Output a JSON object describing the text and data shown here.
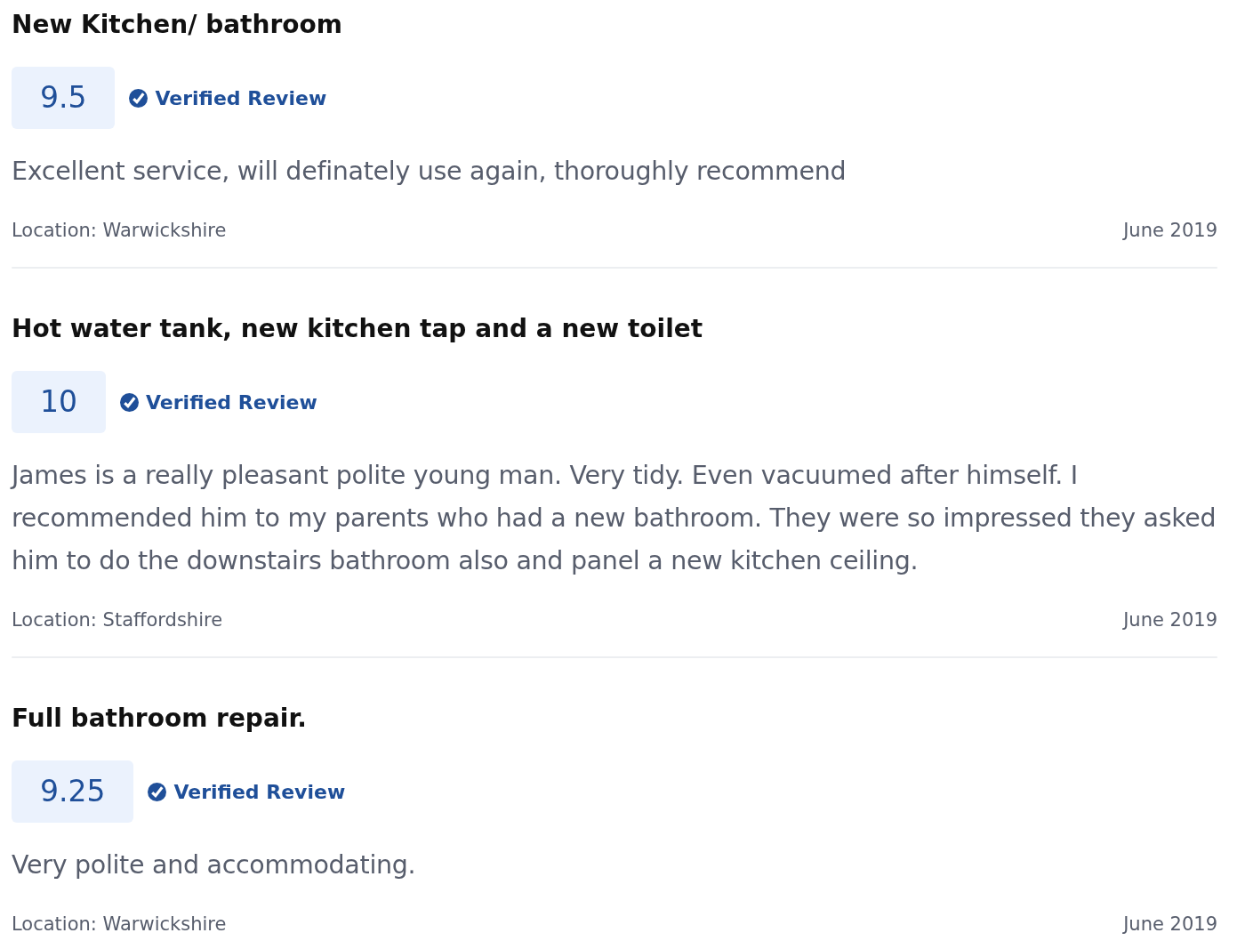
{
  "reviews": [
    {
      "title": "New Kitchen/ bathroom",
      "score": "9.5",
      "verified": true,
      "badge": "Verified Review",
      "text": "Excellent service, will definately use again, thoroughly recommend",
      "location": "Location: Warwickshire",
      "date": "June 2019"
    },
    {
      "title": "Hot water tank, new kitchen tap and a new toilet",
      "score": "10",
      "verified": true,
      "badge": "Verified Review",
      "text": "James is a really pleasant polite young man. Very tidy. Even vacuumed after himself. I recommended him to my parents who had a new bathroom. They were so impressed they asked him to do the downstairs bathroom also and panel a new kitchen ceiling.",
      "location": "Location: Staffordshire",
      "date": "June 2019"
    },
    {
      "title": "Full bathroom repair.",
      "score": "9.25",
      "verified": true,
      "badge": "Verified Review",
      "text": "Very polite and accommodating.",
      "location": "Location: Warwickshire",
      "date": "June 2019"
    }
  ]
}
